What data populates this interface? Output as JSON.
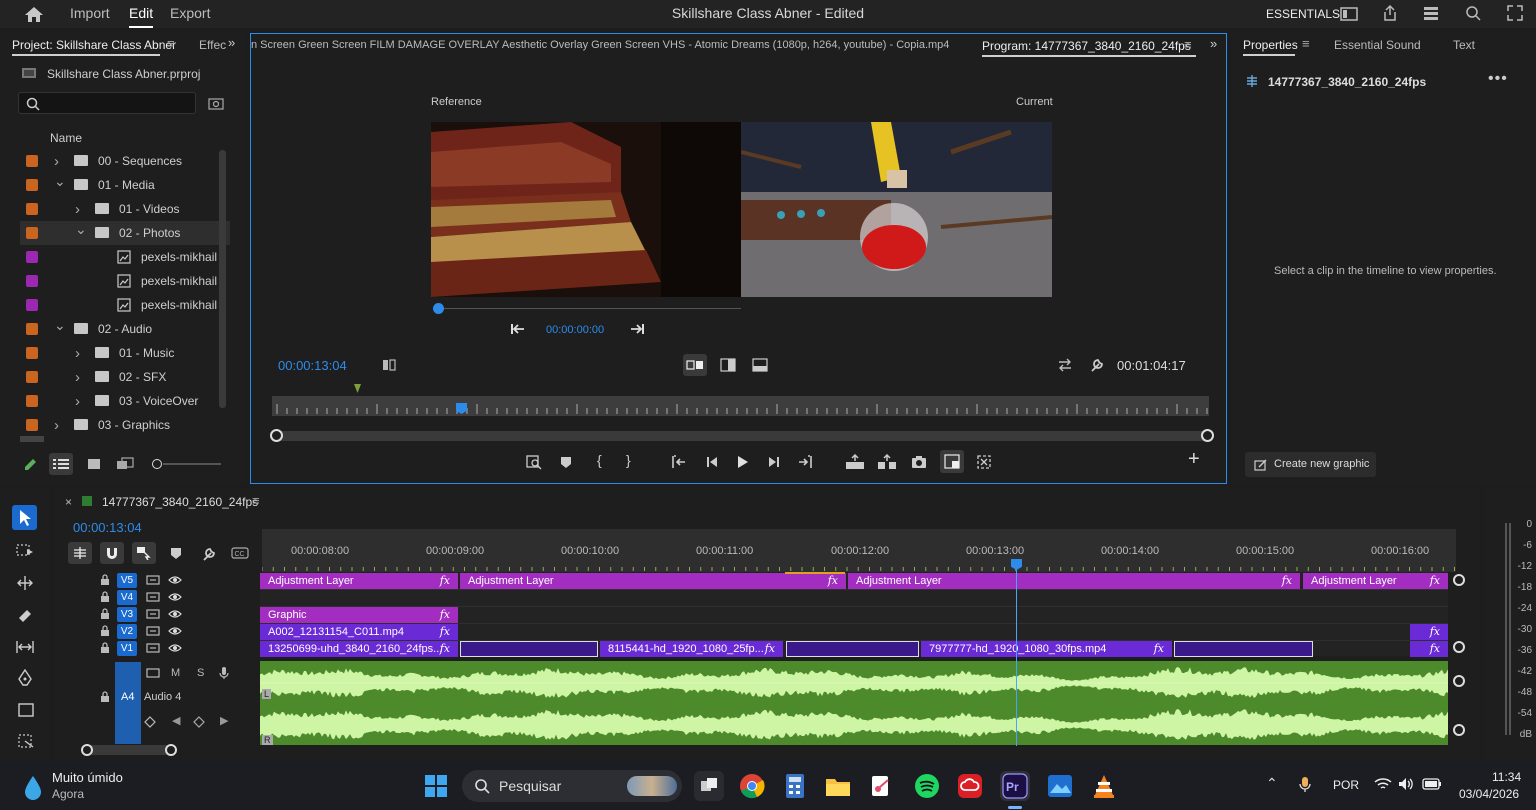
{
  "topbar": {
    "menus": [
      "Import",
      "Edit",
      "Export"
    ],
    "active_menu": "Edit",
    "title": "Skillshare Class Abner - Edited",
    "workspace": "ESSENTIALS"
  },
  "project_panel": {
    "tab_label": "Project: Skillshare Class Abner",
    "tab_next": "Effec",
    "file_name": "Skillshare Class Abner.prproj",
    "search_placeholder": "",
    "column_name": "Name",
    "items": [
      {
        "label": "00 - Sequences",
        "color": "#c9651e",
        "type": "folder",
        "indent": 0,
        "expanded": false
      },
      {
        "label": "01 - Media",
        "color": "#c9651e",
        "type": "folder",
        "indent": 0,
        "expanded": true
      },
      {
        "label": "01 - Videos",
        "color": "#c9651e",
        "type": "folder",
        "indent": 1,
        "expanded": false
      },
      {
        "label": "02 - Photos",
        "color": "#c9651e",
        "type": "folder",
        "indent": 1,
        "expanded": true
      },
      {
        "label": "pexels-mikhail",
        "color": "#9c27b0",
        "type": "image",
        "indent": 2
      },
      {
        "label": "pexels-mikhail",
        "color": "#9c27b0",
        "type": "image",
        "indent": 2
      },
      {
        "label": "pexels-mikhail",
        "color": "#9c27b0",
        "type": "image",
        "indent": 2
      },
      {
        "label": "02 - Audio",
        "color": "#c9651e",
        "type": "folder",
        "indent": 0,
        "expanded": true
      },
      {
        "label": "01 - Music",
        "color": "#c9651e",
        "type": "folder",
        "indent": 1,
        "expanded": false
      },
      {
        "label": "02 - SFX",
        "color": "#c9651e",
        "type": "folder",
        "indent": 1,
        "expanded": false
      },
      {
        "label": "03 - VoiceOver",
        "color": "#c9651e",
        "type": "folder",
        "indent": 1,
        "expanded": false
      },
      {
        "label": "03 - Graphics",
        "color": "#c9651e",
        "type": "folder",
        "indent": 0,
        "expanded": false
      }
    ]
  },
  "program_panel": {
    "tabs_text": "n Screen  Green Screen  FILM DAMAGE OVERLAY  Aesthetic Overlay Green Screen  VHS - Atomic Dreams (1080p, h264, youtube) - Copia.mp4",
    "program_tab": "Program: 14777367_3840_2160_24fps",
    "reference_label": "Reference",
    "current_label": "Current",
    "reference_timecode": "00:00:00:00",
    "timecode": "00:00:13:04",
    "duration": "00:01:04:17"
  },
  "properties_panel": {
    "tabs": [
      "Properties",
      "Essential Sound",
      "Text"
    ],
    "clip_name": "14777367_3840_2160_24fps",
    "empty_message": "Select a clip in the timeline to view properties.",
    "create_graphic": "Create new graphic"
  },
  "timeline": {
    "sequence_name": "14777367_3840_2160_24fps",
    "timecode": "00:00:13:04",
    "ruler": [
      "00:00:08:00",
      "00:00:09:00",
      "00:00:10:00",
      "00:00:11:00",
      "00:00:12:00",
      "00:00:13:00",
      "00:00:14:00",
      "00:00:15:00",
      "00:00:16:00"
    ],
    "tracks": [
      "V5",
      "V4",
      "V3",
      "V2",
      "V1"
    ],
    "audio_track": "A4",
    "audio_name": "Audio 4",
    "audio_buttons": [
      "M",
      "S"
    ],
    "clips": {
      "v5": [
        "Adjustment Layer",
        "Adjustment Layer",
        "Adjustment Layer",
        "Adjustment Layer"
      ],
      "v3": "Graphic",
      "v2": "A002_12131154_C011.mp4",
      "v1": [
        "13250699-uhd_3840_2160_24fps...",
        "8115441-hd_1920_1080_25fp...",
        "7977777-hd_1920_1080_30fps.mp4"
      ]
    },
    "fx": "fx",
    "channel_left": "L",
    "channel_right": "R"
  },
  "meter": {
    "labels": [
      "0",
      "-6",
      "-12",
      "-18",
      "-24",
      "-30",
      "-36",
      "-42",
      "-48",
      "-54",
      "dB"
    ]
  },
  "taskbar": {
    "weather_title": "Muito úmido",
    "weather_sub": "Agora",
    "search": "Pesquisar",
    "lang": "POR",
    "time": "11:34",
    "date": "03/04/2026"
  },
  "colors": {
    "accent": "#2d8ceb",
    "adjustment_clip": "#a22dc0",
    "video_clip": "#6a2ad6",
    "audio_wave": "#4c8a2c",
    "audio_wave_light": "#cdf5a4"
  }
}
